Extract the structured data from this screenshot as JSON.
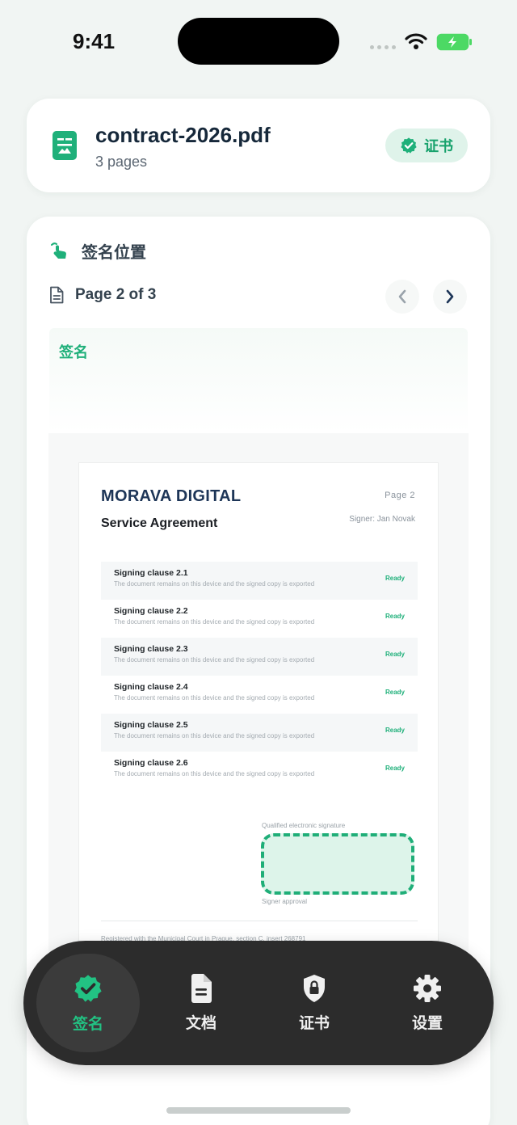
{
  "status_bar": {
    "time": "9:41"
  },
  "file": {
    "name": "contract-2026.pdf",
    "pages": "3 pages",
    "cert_label": "证书"
  },
  "section": {
    "title": "签名位置"
  },
  "page_nav": {
    "label": "Page 2 of 3"
  },
  "signature_tag": "签名",
  "document": {
    "brand": "MORAVA DIGITAL",
    "title": "Service Agreement",
    "page_label": "Page  2",
    "signer": "Signer: Jan Novak",
    "clauses": [
      {
        "title": "Signing clause 2.1",
        "desc": "The document remains on this device and the signed copy is exported",
        "status": "Ready"
      },
      {
        "title": "Signing clause 2.2",
        "desc": "The document remains on this device and the signed copy is exported",
        "status": "Ready"
      },
      {
        "title": "Signing clause 2.3",
        "desc": "The document remains on this device and the signed copy is exported",
        "status": "Ready"
      },
      {
        "title": "Signing clause 2.4",
        "desc": "The document remains on this device and the signed copy is exported",
        "status": "Ready"
      },
      {
        "title": "Signing clause 2.5",
        "desc": "The document remains on this device and the signed copy is exported",
        "status": "Ready"
      },
      {
        "title": "Signing clause 2.6",
        "desc": "The document remains on this device and the signed copy is exported",
        "status": "Ready"
      }
    ],
    "signature_label": "Qualified electronic signature",
    "approval_label": "Signer approval",
    "footer": "Registered with the Municipal Court in Prague, section C, insert 268791"
  },
  "tabs": [
    {
      "label": "签名",
      "icon": "signature-badge-icon",
      "active": true
    },
    {
      "label": "文档",
      "icon": "document-icon",
      "active": false
    },
    {
      "label": "证书",
      "icon": "lock-shield-icon",
      "active": false
    },
    {
      "label": "设置",
      "icon": "gear-icon",
      "active": false
    }
  ],
  "colors": {
    "accent": "#1fb07a",
    "tabbar": "#2c2c2c",
    "background": "#f1f5f3"
  }
}
